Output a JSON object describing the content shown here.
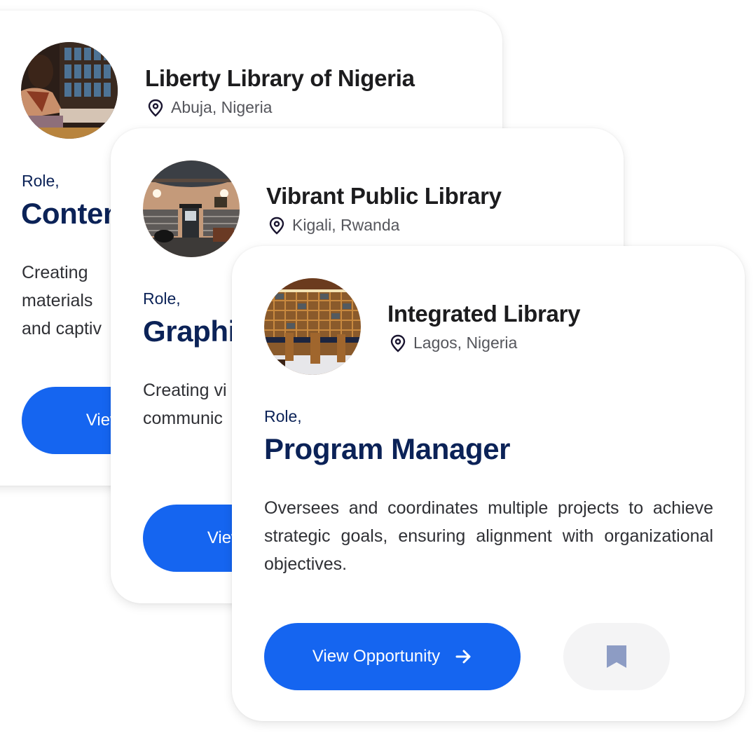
{
  "colors": {
    "primary_button": "#1565f0",
    "role_text": "#0b2257",
    "bookmark_icon": "#8d9cc4",
    "bookmark_bg": "#f4f4f5"
  },
  "cards": [
    {
      "organization": "Liberty Library of Nigeria",
      "location": "Abuja, Nigeria",
      "role_label": "Role,",
      "role_title": "Content Creator",
      "description_visible": "Creating materials and captiv",
      "description_lines": [
        "Creating",
        "materials",
        "and captiv"
      ],
      "button_label": "View Opportunity",
      "avatar": "woman-working-on-laptop-in-library-photo"
    },
    {
      "organization": "Vibrant Public Library",
      "location": "Kigali, Rwanda",
      "role_label": "Role,",
      "role_title": "Graphic Designer",
      "description_lines": [
        "Creating vi",
        "communic"
      ],
      "button_label": "View Opportunity",
      "avatar": "public-library-interior-photo"
    },
    {
      "organization": "Integrated Library",
      "location": "Lagos, Nigeria",
      "role_label": "Role,",
      "role_title": "Program Manager",
      "description": "Oversees and coordinates multiple projects to achieve strategic goals, ensuring alignment with organizational objectives.",
      "button_label": "View Opportunity",
      "button_icon": "arrow-right-icon",
      "bookmark_icon": "bookmark-icon",
      "avatar": "wooden-bookshelves-library-photo"
    }
  ]
}
